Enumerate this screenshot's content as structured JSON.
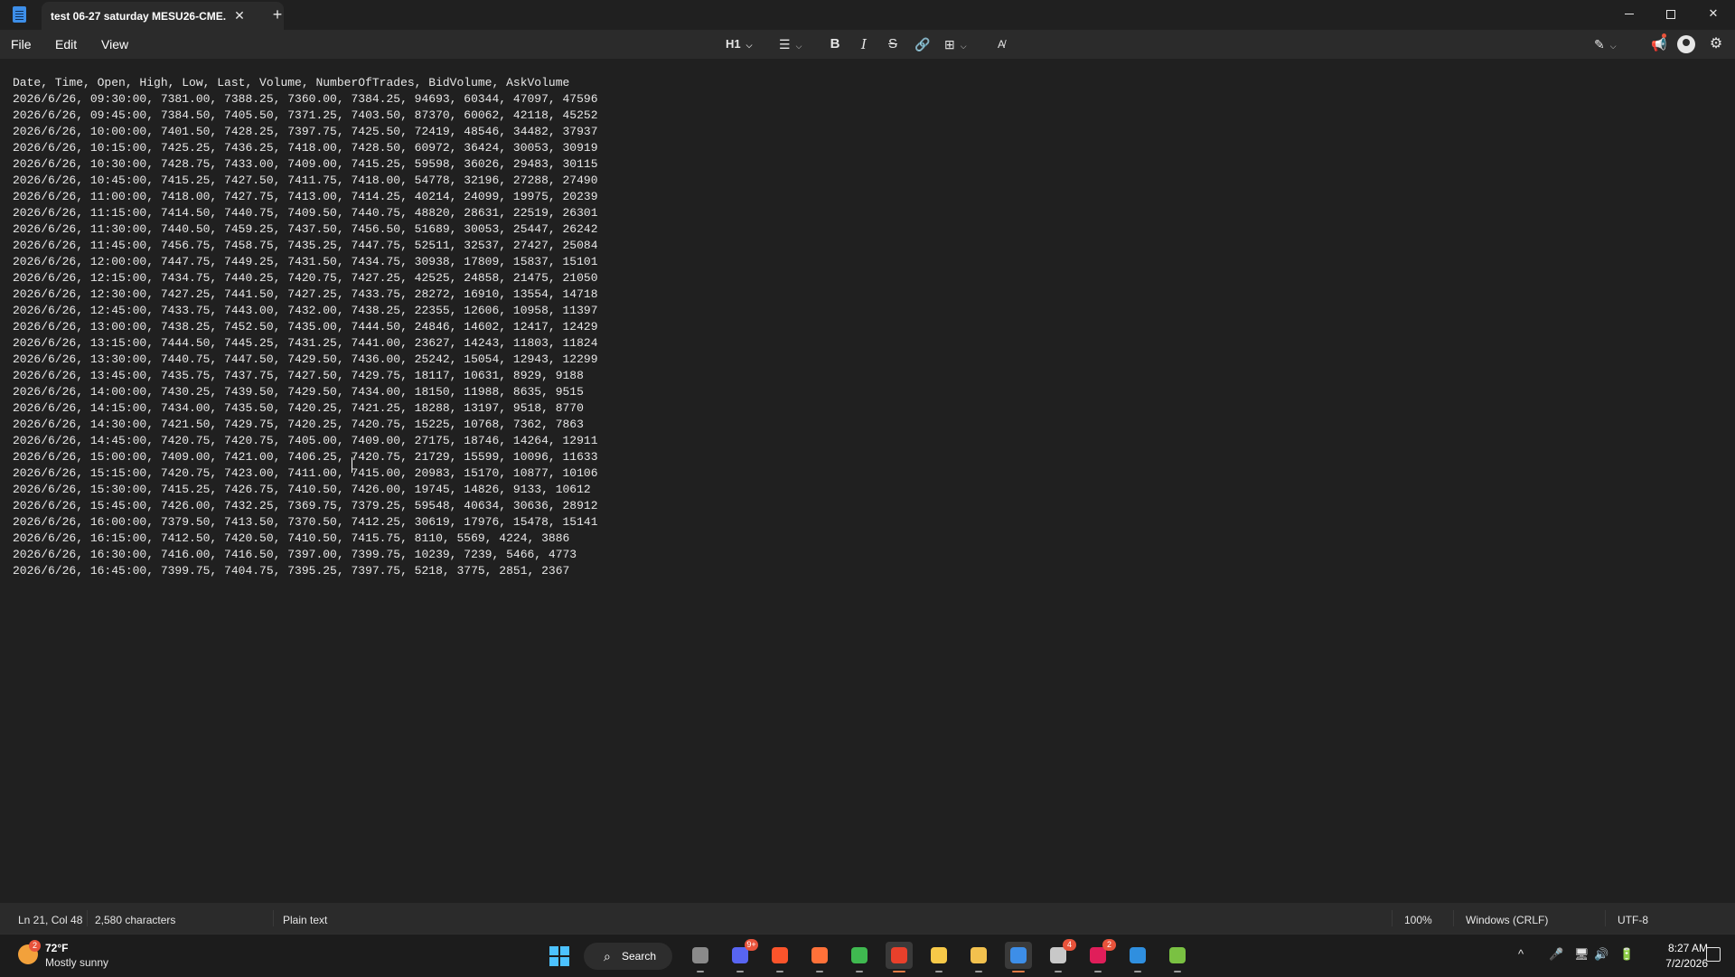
{
  "window": {
    "tab_title": "test 06-27 saturday MESU26-CME.",
    "close_tab_glyph": "✕",
    "new_tab_glyph": "+",
    "close_glyph": "✕"
  },
  "menu": {
    "file": "File",
    "edit": "Edit",
    "view": "View"
  },
  "toolbar": {
    "heading": "H1",
    "chevron": "⌵",
    "list_icon": "☰",
    "bold": "B",
    "italic": "I",
    "strike": "S",
    "link_icon": "🔗",
    "table_icon": "⊞",
    "clear_icon": "A̸",
    "write_icon": "✎",
    "share_icon": "📢",
    "settings_icon": "⚙"
  },
  "document": {
    "lines": [
      "Date, Time, Open, High, Low, Last, Volume, NumberOfTrades, BidVolume, AskVolume",
      "2026/6/26, 09:30:00, 7381.00, 7388.25, 7360.00, 7384.25, 94693, 60344, 47097, 47596",
      "2026/6/26, 09:45:00, 7384.50, 7405.50, 7371.25, 7403.50, 87370, 60062, 42118, 45252",
      "2026/6/26, 10:00:00, 7401.50, 7428.25, 7397.75, 7425.50, 72419, 48546, 34482, 37937",
      "2026/6/26, 10:15:00, 7425.25, 7436.25, 7418.00, 7428.50, 60972, 36424, 30053, 30919",
      "2026/6/26, 10:30:00, 7428.75, 7433.00, 7409.00, 7415.25, 59598, 36026, 29483, 30115",
      "2026/6/26, 10:45:00, 7415.25, 7427.50, 7411.75, 7418.00, 54778, 32196, 27288, 27490",
      "2026/6/26, 11:00:00, 7418.00, 7427.75, 7413.00, 7414.25, 40214, 24099, 19975, 20239",
      "2026/6/26, 11:15:00, 7414.50, 7440.75, 7409.50, 7440.75, 48820, 28631, 22519, 26301",
      "2026/6/26, 11:30:00, 7440.50, 7459.25, 7437.50, 7456.50, 51689, 30053, 25447, 26242",
      "2026/6/26, 11:45:00, 7456.75, 7458.75, 7435.25, 7447.75, 52511, 32537, 27427, 25084",
      "2026/6/26, 12:00:00, 7447.75, 7449.25, 7431.50, 7434.75, 30938, 17809, 15837, 15101",
      "2026/6/26, 12:15:00, 7434.75, 7440.25, 7420.75, 7427.25, 42525, 24858, 21475, 21050",
      "2026/6/26, 12:30:00, 7427.25, 7441.50, 7427.25, 7433.75, 28272, 16910, 13554, 14718",
      "2026/6/26, 12:45:00, 7433.75, 7443.00, 7432.00, 7438.25, 22355, 12606, 10958, 11397",
      "2026/6/26, 13:00:00, 7438.25, 7452.50, 7435.00, 7444.50, 24846, 14602, 12417, 12429",
      "2026/6/26, 13:15:00, 7444.50, 7445.25, 7431.25, 7441.00, 23627, 14243, 11803, 11824",
      "2026/6/26, 13:30:00, 7440.75, 7447.50, 7429.50, 7436.00, 25242, 15054, 12943, 12299",
      "2026/6/26, 13:45:00, 7435.75, 7437.75, 7427.50, 7429.75, 18117, 10631, 8929, 9188",
      "2026/6/26, 14:00:00, 7430.25, 7439.50, 7429.50, 7434.00, 18150, 11988, 8635, 9515",
      "2026/6/26, 14:15:00, 7434.00, 7435.50, 7420.25, 7421.25, 18288, 13197, 9518, 8770",
      "2026/6/26, 14:30:00, 7421.50, 7429.75, 7420.25, 7420.75, 15225, 10768, 7362, 7863",
      "2026/6/26, 14:45:00, 7420.75, 7420.75, 7405.00, 7409.00, 27175, 18746, 14264, 12911",
      "2026/6/26, 15:00:00, 7409.00, 7421.00, 7406.25, 7420.75, 21729, 15599, 10096, 11633",
      "2026/6/26, 15:15:00, 7420.75, 7423.00, 7411.00, 7415.00, 20983, 15170, 10877, 10106",
      "2026/6/26, 15:30:00, 7415.25, 7426.75, 7410.50, 7426.00, 19745, 14826, 9133, 10612",
      "2026/6/26, 15:45:00, 7426.00, 7432.25, 7369.75, 7379.25, 59548, 40634, 30636, 28912",
      "2026/6/26, 16:00:00, 7379.50, 7413.50, 7370.50, 7412.25, 30619, 17976, 15478, 15141",
      "2026/6/26, 16:15:00, 7412.50, 7420.50, 7410.50, 7415.75, 8110, 5569, 4224, 3886",
      "2026/6/26, 16:30:00, 7416.00, 7416.50, 7397.00, 7399.75, 10239, 7239, 5466, 4773",
      "2026/6/26, 16:45:00, 7399.75, 7404.75, 7395.25, 7397.75, 5218, 3775, 2851, 2367"
    ]
  },
  "status": {
    "position": "Ln 21, Col 48",
    "characters": "2,580 characters",
    "format": "Plain text",
    "zoom": "100%",
    "line_ending": "Windows (CRLF)",
    "encoding": "UTF-8"
  },
  "taskbar": {
    "weather_badge": "2",
    "weather_temp": "72°F",
    "weather_condition": "Mostly sunny",
    "search_label": "Search",
    "search_icon": "⌕",
    "apps": [
      {
        "name": "task-view",
        "color": "#8a8a8a",
        "badge": ""
      },
      {
        "name": "discord",
        "color": "#5865f2",
        "badge": "9+"
      },
      {
        "name": "brave",
        "color": "#fb542b",
        "badge": ""
      },
      {
        "name": "firefox",
        "color": "#ff7139",
        "badge": ""
      },
      {
        "name": "vpn",
        "color": "#3fb950",
        "badge": ""
      },
      {
        "name": "trading-app",
        "color": "#e8402b",
        "badge": ""
      },
      {
        "name": "sticky-notes",
        "color": "#f7c948",
        "badge": ""
      },
      {
        "name": "file-explorer",
        "color": "#f2c14e",
        "badge": ""
      },
      {
        "name": "notepad",
        "color": "#3d8ee8",
        "badge": ""
      },
      {
        "name": "steam",
        "color": "#c8c8c8",
        "badge": "4"
      },
      {
        "name": "slack",
        "color": "#e01e5a",
        "badge": "2"
      },
      {
        "name": "photos",
        "color": "#2f8fdf",
        "badge": ""
      },
      {
        "name": "terminal-app",
        "color": "#7ac142",
        "badge": ""
      }
    ],
    "tray_chevron": "^",
    "time": "8:27 AM",
    "date": "7/2/2026"
  }
}
